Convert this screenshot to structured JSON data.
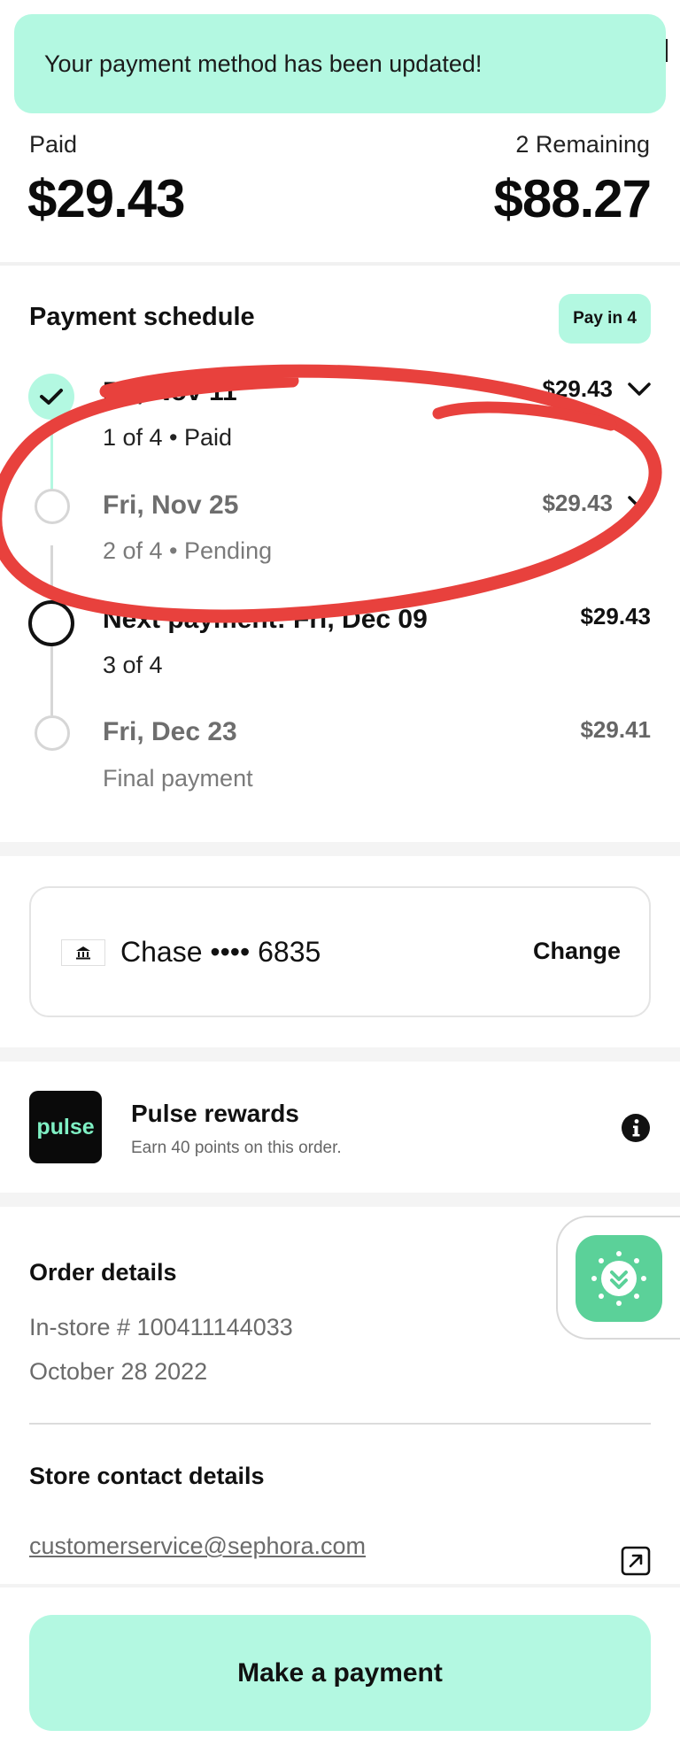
{
  "toast": {
    "message": "Your payment method has been updated!"
  },
  "summary": {
    "paid_label": "Paid",
    "paid_amount": "$29.43",
    "remaining_label": "2 Remaining",
    "remaining_amount": "$88.27"
  },
  "schedule": {
    "title": "Payment schedule",
    "badge": "Pay in 4",
    "items": [
      {
        "title": "Fri, Nov 11",
        "sub": "1 of 4 • Paid",
        "amount": "$29.43",
        "status": "paid"
      },
      {
        "title": "Fri, Nov 25",
        "sub": "2 of 4 • Pending",
        "amount": "$29.43",
        "status": "pending"
      },
      {
        "title": "Next payment: Fri, Dec 09",
        "sub": "3 of 4",
        "amount": "$29.43",
        "status": "next"
      },
      {
        "title": "Fri, Dec 23",
        "sub": "Final payment",
        "amount": "$29.41",
        "status": "upcoming"
      }
    ]
  },
  "payment_method": {
    "bank": "Chase •••• 6835",
    "change_label": "Change",
    "icon": "bank-icon"
  },
  "rewards": {
    "logo_text": "pulse",
    "title": "Pulse rewards",
    "subtitle": "Earn 40 points on this order.",
    "icon": "info-icon"
  },
  "order": {
    "title": "Order details",
    "store_number": "In-store # 100411144033",
    "date": "October 28 2022"
  },
  "contact": {
    "title": "Store contact details",
    "email": "customerservice@sephora.com",
    "icon": "external-link-icon"
  },
  "actions": {
    "make_payment": "Make a payment"
  },
  "colors": {
    "accent_mint": "#b3f8e1",
    "widget_green": "#5bd199",
    "annotation_red": "#e8413d",
    "text_primary": "#111111",
    "text_muted": "#6b6b6b"
  }
}
